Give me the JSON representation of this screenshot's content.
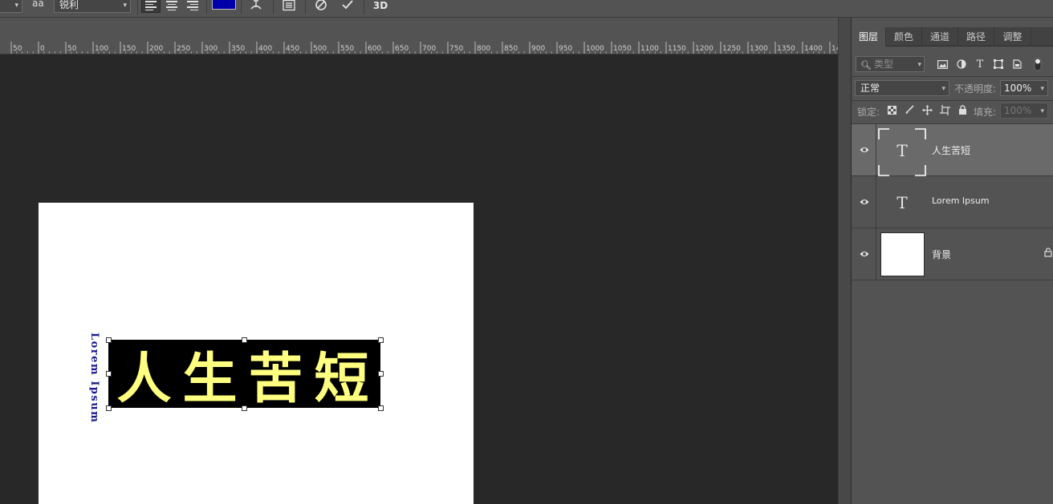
{
  "options_bar": {
    "antialias_icon": "aa",
    "antialias_value": "锐利",
    "text_color": "#0000aa",
    "threed_label": "3D"
  },
  "ruler": {
    "labels": [
      "50",
      "0",
      "50",
      "100",
      "150",
      "200",
      "250",
      "300",
      "350",
      "400",
      "450",
      "500",
      "550",
      "600",
      "650",
      "700",
      "750",
      "800",
      "850",
      "900",
      "950",
      "1000",
      "1050",
      "1100",
      "1150",
      "1200",
      "1250",
      "1300",
      "1350",
      "1400",
      "14"
    ]
  },
  "canvas": {
    "vertical_text": "Lorem Ipsum",
    "title_text": "人生苦短",
    "title_color": "#ffff80",
    "title_bg": "#000000",
    "vertical_color": "#1a1a8c"
  },
  "layers_panel": {
    "tabs": [
      "图层",
      "颜色",
      "通道",
      "路径",
      "调整"
    ],
    "active_tab": "图层",
    "filter_placeholder": "类型",
    "blend_mode": "正常",
    "opacity_label": "不透明度:",
    "opacity_value": "100%",
    "lock_label": "锁定:",
    "fill_label": "填充:",
    "fill_value": "100%",
    "layers": [
      {
        "name": "人生苦短",
        "type": "text",
        "selected": true
      },
      {
        "name": "Lorem Ipsum",
        "type": "text",
        "selected": false
      },
      {
        "name": "背景",
        "type": "background",
        "selected": false,
        "locked": true
      }
    ]
  }
}
